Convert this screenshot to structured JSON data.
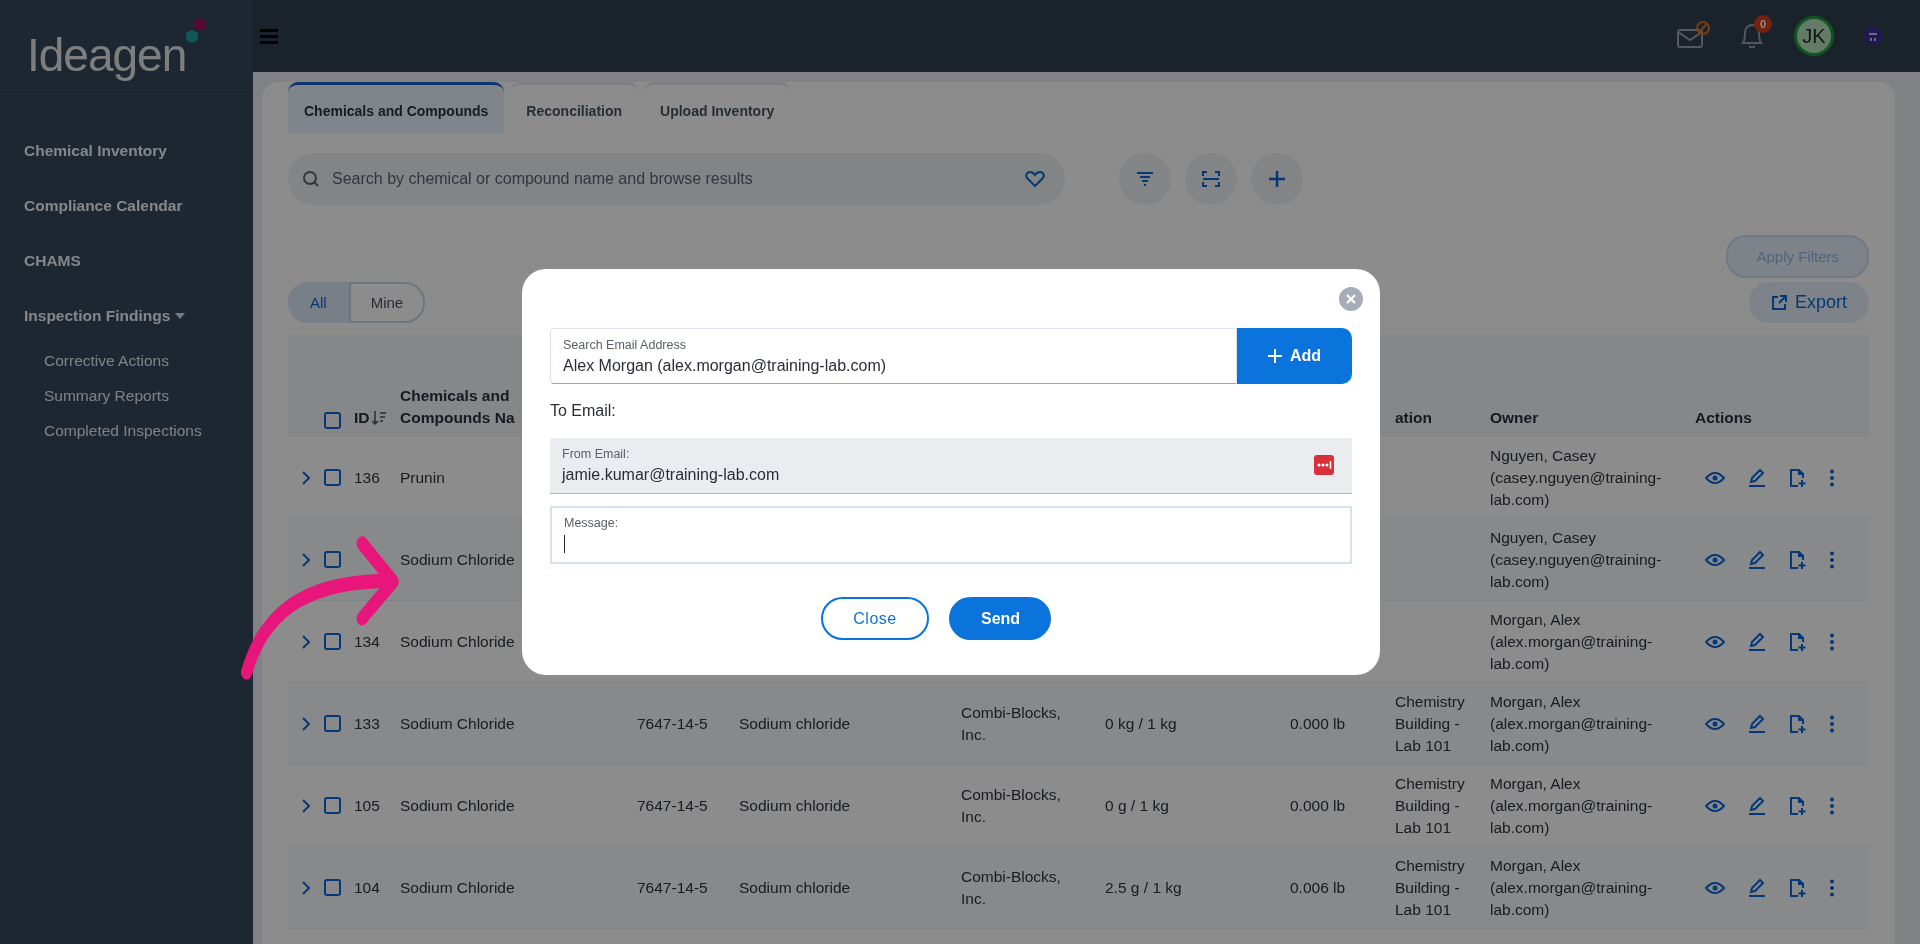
{
  "topbar": {
    "logo": "Ideagen",
    "notification_count": "0",
    "avatar_initials": "JK"
  },
  "sidebar": {
    "items": [
      {
        "label": "Chemical Inventory"
      },
      {
        "label": "Compliance Calendar"
      },
      {
        "label": "CHAMS"
      },
      {
        "label": "Inspection Findings",
        "expanded": true,
        "children": [
          {
            "label": "Corrective Actions"
          },
          {
            "label": "Summary Reports"
          },
          {
            "label": "Completed Inspections"
          }
        ]
      }
    ]
  },
  "tabs": [
    {
      "label": "Chemicals and Compounds",
      "selected": true
    },
    {
      "label": "Reconciliation",
      "selected": false
    },
    {
      "label": "Upload Inventory",
      "selected": false
    }
  ],
  "search": {
    "placeholder": "Search by chemical or compound name and browse results"
  },
  "apply_filters": {
    "label": "Apply Filters",
    "disabled": true
  },
  "export": {
    "label": "Export"
  },
  "scope": [
    {
      "label": "All",
      "selected": true
    },
    {
      "label": "Mine",
      "selected": false
    }
  ],
  "table": {
    "header": {
      "id": "ID",
      "name": "Chemicals and Compounds Na",
      "location": "ation",
      "owner": "Owner",
      "actions": "Actions"
    },
    "header_checked": false,
    "rows": [
      {
        "expanded": false,
        "checked": false,
        "id": "136",
        "name": "Prunin",
        "owner": "Nguyen, Casey (casey.nguyen@training-lab.com)"
      },
      {
        "expanded": false,
        "checked": false,
        "name": "Sodium Chloride",
        "owner": "Nguyen, Casey (casey.nguyen@training-lab.com)"
      },
      {
        "expanded": false,
        "checked": false,
        "id": "134",
        "name": "Sodium Chloride",
        "owner": "Morgan, Alex (alex.morgan@training-lab.com)"
      },
      {
        "expanded": false,
        "checked": false,
        "id": "133",
        "name": "Sodium Chloride",
        "cas": "7647-14-5",
        "chemical": "Sodium chloride",
        "supplier": "Combi-Blocks, Inc.",
        "amount": "0 kg / 1 kg",
        "weight": "0.000 lb",
        "location": "Chemistry Building - Lab 101",
        "owner": "Morgan, Alex (alex.morgan@training-lab.com)"
      },
      {
        "expanded": false,
        "checked": false,
        "id": "105",
        "name": "Sodium Chloride",
        "cas": "7647-14-5",
        "chemical": "Sodium chloride",
        "supplier": "Combi-Blocks, Inc.",
        "amount": "0 g / 1 kg",
        "weight": "0.000 lb",
        "location": "Chemistry Building - Lab 101",
        "owner": "Morgan, Alex (alex.morgan@training-lab.com)"
      },
      {
        "expanded": false,
        "checked": false,
        "id": "104",
        "name": "Sodium Chloride",
        "cas": "7647-14-5",
        "chemical": "Sodium chloride",
        "supplier": "Combi-Blocks, Inc.",
        "amount": "2.5 g / 1 kg",
        "weight": "0.006 lb",
        "location": "Chemistry Building - Lab 101",
        "owner": "Morgan, Alex (alex.morgan@training-lab.com)"
      }
    ]
  },
  "dialog": {
    "search_label": "Search Email Address",
    "search_value": "Alex Morgan (alex.morgan@training-lab.com)",
    "add_button": "Add",
    "to_label": "To Email:",
    "from_label": "From Email:",
    "from_value": "jamie.kumar@training-lab.com",
    "message_label": "Message:",
    "buttons": [
      {
        "label": "Close",
        "kind": "outline"
      },
      {
        "label": "Send",
        "kind": "primary"
      }
    ]
  }
}
